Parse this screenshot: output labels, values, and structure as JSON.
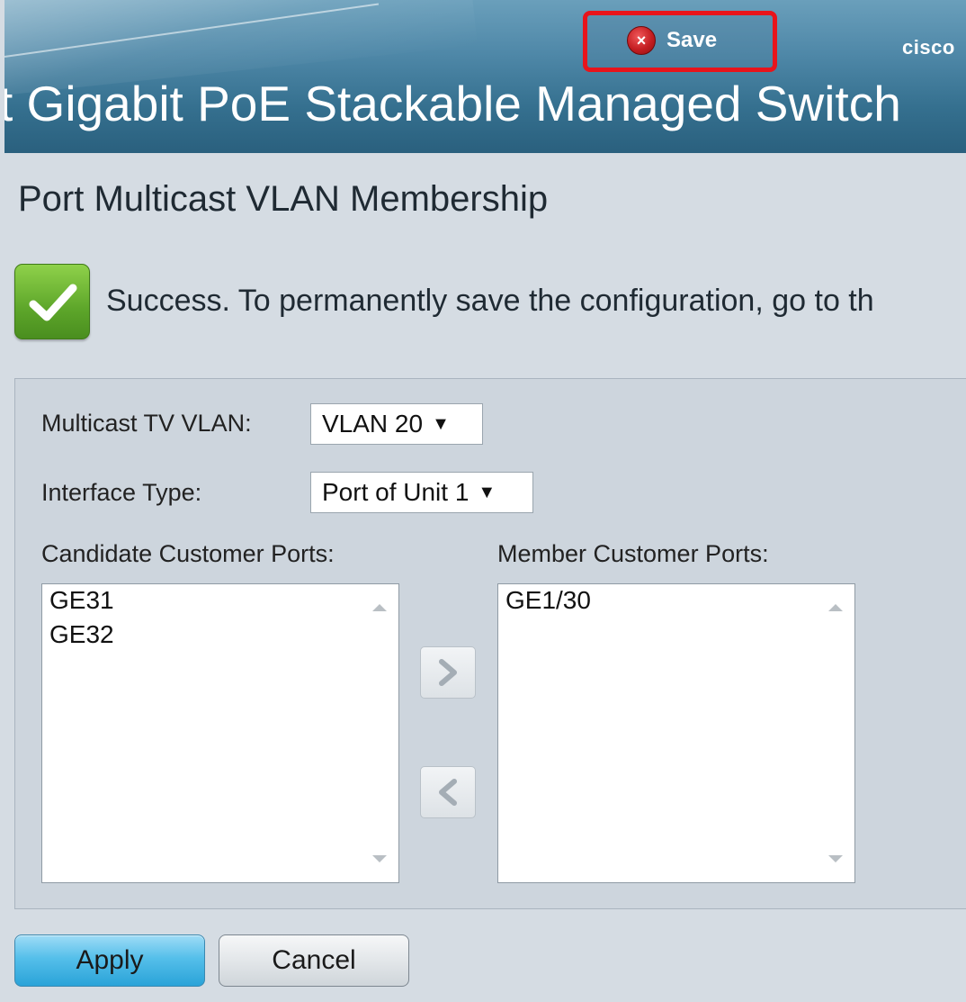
{
  "header": {
    "save_label": "Save",
    "brand": "cisco",
    "product_title": "t Gigabit PoE Stackable Managed Switch"
  },
  "page": {
    "title": "Port Multicast VLAN Membership"
  },
  "status": {
    "message": "Success. To permanently save the configuration, go to th"
  },
  "form": {
    "multicast_vlan": {
      "label": "Multicast TV VLAN:",
      "value": "VLAN 20"
    },
    "interface_type": {
      "label": "Interface Type:",
      "value": "Port of Unit 1"
    },
    "candidate": {
      "label": "Candidate Customer Ports:",
      "items": [
        "GE31",
        "GE32"
      ]
    },
    "member": {
      "label": "Member Customer Ports:",
      "items": [
        "GE1/30"
      ]
    }
  },
  "buttons": {
    "apply": "Apply",
    "cancel": "Cancel"
  },
  "colors": {
    "header": "#35708f",
    "highlight": "#e8141b",
    "success": "#5da62a",
    "apply": "#2aa3d8"
  }
}
